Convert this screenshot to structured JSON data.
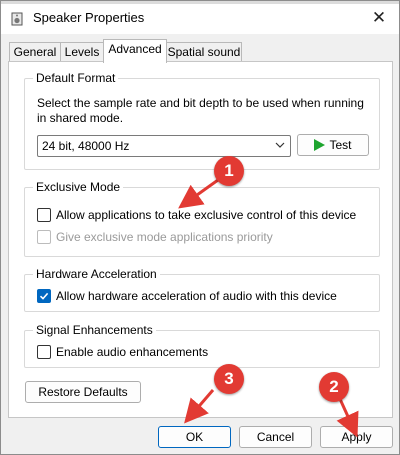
{
  "window": {
    "title": "Speaker Properties",
    "close_glyph": "✕"
  },
  "tabs": [
    {
      "label": "General"
    },
    {
      "label": "Levels"
    },
    {
      "label": "Advanced",
      "active": true
    },
    {
      "label": "Spatial sound"
    }
  ],
  "default_format": {
    "heading": "Default Format",
    "description_line1": "Select the sample rate and bit depth to be used when running",
    "description_line2": "in shared mode.",
    "selected": "24 bit, 48000 Hz",
    "test_label": "Test"
  },
  "exclusive_mode": {
    "heading": "Exclusive Mode",
    "allow_label": "Allow applications to take exclusive control of this device",
    "allow_checked": false,
    "priority_label": "Give exclusive mode applications priority",
    "priority_checked": false,
    "priority_enabled": false
  },
  "hardware_acceleration": {
    "heading": "Hardware Acceleration",
    "label": "Allow hardware acceleration of audio with this device",
    "checked": true
  },
  "signal_enhancements": {
    "heading": "Signal Enhancements",
    "label": "Enable audio enhancements",
    "checked": false
  },
  "restore_defaults_label": "Restore Defaults",
  "footer": {
    "ok_label": "OK",
    "cancel_label": "Cancel",
    "apply_label": "Apply"
  },
  "annotations": [
    {
      "number": "1"
    },
    {
      "number": "2"
    },
    {
      "number": "3"
    }
  ],
  "colors": {
    "annotation": "#e23a33",
    "accent": "#0067c0",
    "test_icon": "#1ea52f"
  }
}
